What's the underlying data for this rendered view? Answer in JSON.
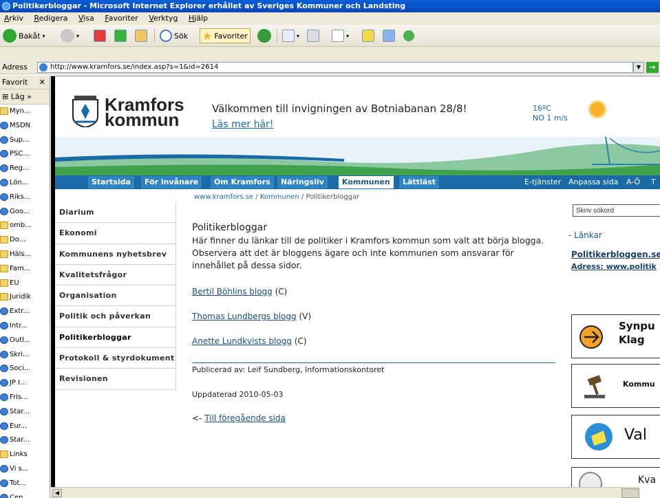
{
  "window": {
    "title": "Politikerbloggar - Microsoft Internet Explorer erhållet av Sveriges Kommuner och Landsting"
  },
  "menu": [
    "Arkiv",
    "Redigera",
    "Visa",
    "Favoriter",
    "Verktyg",
    "Hjälp"
  ],
  "toolbar": {
    "back_label": "Bakåt",
    "search_label": "Sök",
    "favorites_label": "Favoriter"
  },
  "address": {
    "label": "Adress",
    "url": "http://www.kramfors.se/index.asp?s=1&id=2614"
  },
  "favorites": {
    "title": "Favorit",
    "add_label": "Läg",
    "items": [
      {
        "label": "Myn...",
        "type": "folder"
      },
      {
        "label": "MSDN",
        "type": "ie"
      },
      {
        "label": "Sup...",
        "type": "ie"
      },
      {
        "label": "PSC...",
        "type": "ie"
      },
      {
        "label": "Reg...",
        "type": "ie"
      },
      {
        "label": "Lön...",
        "type": "ie"
      },
      {
        "label": "Riks...",
        "type": "ie"
      },
      {
        "label": "Goo...",
        "type": "ie"
      },
      {
        "label": "omb...",
        "type": "folder"
      },
      {
        "label": "Do...",
        "type": "folder"
      },
      {
        "label": "Häls...",
        "type": "folder"
      },
      {
        "label": "Fam...",
        "type": "folder"
      },
      {
        "label": "EU",
        "type": "folder"
      },
      {
        "label": "Juridik",
        "type": "folder"
      },
      {
        "label": "Extr...",
        "type": "ie"
      },
      {
        "label": "Intr...",
        "type": "ie"
      },
      {
        "label": "Outl...",
        "type": "ie"
      },
      {
        "label": "Skri...",
        "type": "ie"
      },
      {
        "label": "Soci...",
        "type": "ie"
      },
      {
        "label": "JP I...",
        "type": "ie"
      },
      {
        "label": "Fris...",
        "type": "ie"
      },
      {
        "label": "Star...",
        "type": "ie"
      },
      {
        "label": "Eur...",
        "type": "ie"
      },
      {
        "label": "Star...",
        "type": "ie"
      },
      {
        "label": "Links",
        "type": "folder"
      },
      {
        "label": "Vi s...",
        "type": "ie"
      },
      {
        "label": "Tot...",
        "type": "ie"
      },
      {
        "label": "Cen...",
        "type": "ie"
      }
    ]
  },
  "site": {
    "logo_line1": "Kramfors",
    "logo_line2": "kommun",
    "welcome": "Välkommen till invigningen av Botniabanan 28/8!",
    "welcome_link": "Läs mer här!",
    "temperature": "16ºC",
    "wind": "NO 1 m/s",
    "nav": [
      "Startsida",
      "För invånare",
      "Om Kramfors",
      "Näringsliv",
      "Kommunen",
      "Lättläst"
    ],
    "nav_active": "Kommunen",
    "nav_right": [
      "E-tjänster",
      "Anpassa sida",
      "A-Ö",
      "T"
    ],
    "breadcrumb": {
      "site": "www.kramfors.se",
      "sep": "/",
      "section": "Kommunen",
      "current": "Politikerbloggar"
    },
    "leftnav": [
      "Diarium",
      "Ekonomi",
      "Kommunens nyhetsbrev",
      "Kvalitetsfrågor",
      "Organisation",
      "Politik och påverkan",
      "Politikerbloggar",
      "Protokoll & styrdokument",
      "Revisionen"
    ],
    "leftnav_active": "Politikerbloggar",
    "page_title": "Politikerbloggar",
    "intro": "Här finner du länkar till de politiker i Kramfors kommun som valt att börja blogga. Observera att det är bloggens ägare och inte kommunen som ansvarar för innehållet på dessa sidor.",
    "blogs": [
      {
        "name": "Bertil Böhlins blogg",
        "party": "(C)"
      },
      {
        "name": "Thomas Lundbergs blogg",
        "party": "(V)"
      },
      {
        "name": "Anette Lundkvists blogg",
        "party": "(C)"
      }
    ],
    "published": "Publicerad av: Leif Sundberg, Informationskontoret",
    "updated": "Uppdaterad 2010-05-03",
    "back_prefix": "<-",
    "back_link": "Till föregående sida",
    "search_placeholder": "Skriv sökord",
    "links_heading": "- Länkar",
    "links": [
      "Politikerbloggen.se",
      "Adress: www.politik"
    ],
    "banners": [
      "Synpu\nKlag",
      "Kommu",
      "Val",
      "Kva"
    ]
  },
  "colors": {
    "nav_blue": "#1a6aa8",
    "link_blue": "#1a4f86",
    "title_blue": "#0a5fd8"
  }
}
